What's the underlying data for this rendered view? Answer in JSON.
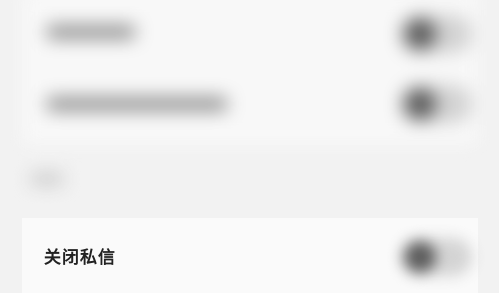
{
  "settings": {
    "close_dm_label": "关闭私信"
  }
}
